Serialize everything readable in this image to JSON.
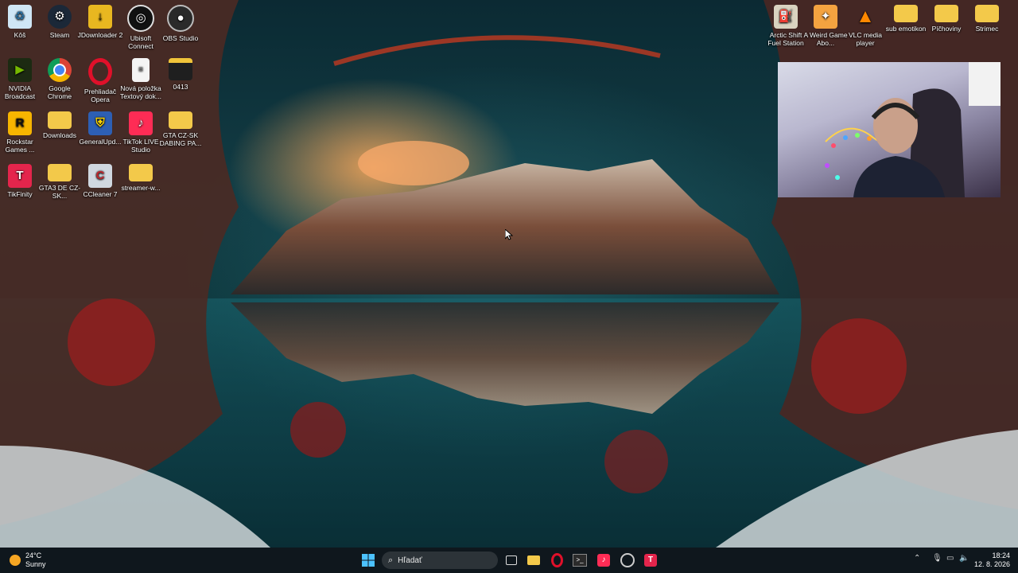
{
  "desktop_icons_left": [
    {
      "label": "Kôš",
      "icon": "recycle-bin-icon"
    },
    {
      "label": "Steam",
      "icon": "steam-icon"
    },
    {
      "label": "JDownloader 2",
      "icon": "jdownloader-icon"
    },
    {
      "label": "Ubisoft Connect",
      "icon": "ubisoft-icon"
    },
    {
      "label": "OBS Studio",
      "icon": "obs-icon"
    },
    {
      "label": "NVIDIA Broadcast",
      "icon": "nvidia-icon"
    },
    {
      "label": "Google Chrome",
      "icon": "chrome-icon"
    },
    {
      "label": "Prehliadač Opera",
      "icon": "opera-icon"
    },
    {
      "label": "Nová položka Textový dok...",
      "icon": "text-document-icon"
    },
    {
      "label": "0413",
      "icon": "folder-icon"
    },
    {
      "label": "Rockstar Games ...",
      "icon": "rockstar-icon"
    },
    {
      "label": "Downloads",
      "icon": "folder-icon"
    },
    {
      "label": "GeneralUpd...",
      "icon": "shield-icon"
    },
    {
      "label": "TikTok LIVE Studio",
      "icon": "tiktok-icon"
    },
    {
      "label": "GTA CZ-SK DABING PA...",
      "icon": "folder-icon"
    },
    {
      "label": "TikFinity",
      "icon": "tikfinity-icon"
    },
    {
      "label": "GTA3 DE CZ-SK...",
      "icon": "folder-icon"
    },
    {
      "label": "CCleaner 7",
      "icon": "ccleaner-icon"
    },
    {
      "label": "streamer-w...",
      "icon": "folder-icon"
    }
  ],
  "desktop_icons_right": [
    {
      "label": "Arctic Shift Fuel Station",
      "icon": "arctic-shift-icon"
    },
    {
      "label": "A Weird Game Abo...",
      "icon": "game-icon"
    },
    {
      "label": "VLC media player",
      "icon": "vlc-icon"
    },
    {
      "label": "sub emotikon",
      "icon": "folder-icon"
    },
    {
      "label": "Píčhoviny",
      "icon": "folder-icon"
    },
    {
      "label": "Strimec",
      "icon": "folder-icon"
    }
  ],
  "weather": {
    "temp": "24°C",
    "condition": "Sunny"
  },
  "taskbar": {
    "search_placeholder": "Hľadať",
    "apps": [
      "start-icon",
      "search-icon",
      "task-view-icon",
      "file-explorer-icon",
      "opera-icon",
      "terminal-icon",
      "tiktok-icon",
      "obs-icon",
      "tikfinity-icon"
    ]
  },
  "clock": {
    "time": "18:24",
    "date": "12. 8. 2026"
  },
  "colors": {
    "accent": "#0078d4",
    "taskbar": "#10161c"
  }
}
